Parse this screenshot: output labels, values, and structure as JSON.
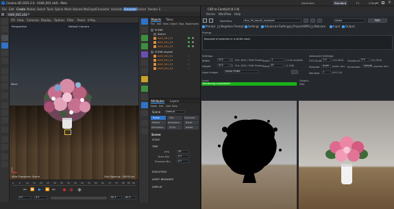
{
  "app": {
    "title": "Cinema 4D 2025.2.0 - [AI49_001.c4d] - Main"
  },
  "tabs": [
    "AI49_001.c4d"
  ],
  "menus": [
    "File",
    "Edit",
    "Create",
    "Modes",
    "Select",
    "Tools",
    "Spline",
    "Mesh",
    "Volume",
    "MoGraph",
    "Character",
    "Animate",
    "Simulate",
    "Tracker",
    "Render",
    "E"
  ],
  "viewport": {
    "menu": [
      "View",
      "Cameras",
      "Display",
      "Options",
      "Filter",
      "Panel",
      "V-Ray"
    ],
    "camera_label": "Perspective",
    "camera_name": "Default Camera",
    "transform_label": "View Transform: Scene",
    "grid_label": "Grid Spacing : 50000 cm",
    "move_label": "Move"
  },
  "timeline": {
    "frames": [
      "0",
      "5",
      "10",
      "15",
      "20",
      "25",
      "30",
      "35",
      "40",
      "45",
      "50",
      "55",
      "60",
      "65",
      "70",
      "75",
      "80",
      "85",
      "90"
    ],
    "start": "0 F",
    "current": "0 F",
    "end": "90 F",
    "end2": "90 F"
  },
  "layouts": {
    "active": "Standard",
    "items": [
      "Attributes",
      "Standard",
      "F1",
      "V-Ray"
    ]
  },
  "objects": {
    "tabs": [
      "Objects",
      "Takes"
    ],
    "menu": [
      "File",
      "Edit",
      "View",
      "Object",
      "Tags",
      "Bookmarks"
    ],
    "rows": [
      "SCENE",
      "Sketch",
      "AI49_001_01",
      "AI49_001_02",
      "AI49_001_03",
      "SCENE.original",
      "AI49_001_01",
      "AI49_001_02",
      "AI49_001_03",
      "AI49_001_04"
    ]
  },
  "attributes": {
    "tabs": [
      "Attributes",
      "Layers"
    ],
    "menu": [
      "Mode",
      "Edit",
      "User Data"
    ],
    "object": "Scene",
    "mode_value": "Default",
    "subtabs": [
      "Scene",
      "Info",
      "Channels",
      "Effects",
      "Animation",
      "Bullet",
      "Simulation",
      "To Do",
      "Nodes"
    ],
    "section": "Scene",
    "groups": [
      "SCALE",
      "TIME",
      "EXECUTION",
      "ASSET BROWSER",
      "DISPLAY"
    ],
    "fps_label": "FPS",
    "fps_value": "30",
    "min_label": "Time Min",
    "min_value": "0 F",
    "preview_label": "Preview Min",
    "preview_value": "0 F"
  },
  "comfy": {
    "title": "C4D to ComfyUI (0.1.6)",
    "menu": [
      "Server",
      "Workflow",
      "Help"
    ],
    "workflow_label": "Workflow",
    "workflow_value": "flux_50_Input1_example",
    "model_value": "Alpha",
    "run_label": "Run",
    "options": [
      "Prompt",
      "Negative Prompt",
      "Settings",
      "Advanced Settings",
      "Project/WPG",
      "Webcam",
      "Input",
      "Output"
    ],
    "prompt_label": "Prompt",
    "prompt_text": "Bouquet of peonies in a white vase",
    "settings_label": "Settings",
    "width_label": "Width",
    "width_value": "512",
    "width_hint": "Ctrl: 1024 / Shift: Preset",
    "height_label": "Height",
    "height_value": "512",
    "height_hint": "Ctrl: 1024 / Shift: Preset",
    "seed_label": "Seed",
    "seed_value": "-1",
    "seed_hint": "(-1 for random)",
    "steps_label": "Steps",
    "steps_value": "20",
    "steps_hint": "(1-100)",
    "input_image_label": "Input Image",
    "input_image_value": "Alpha RGBA",
    "adv_label": "Advanced Settings",
    "cfg_label": "CFG Scale",
    "cfg_value": "1.0",
    "cfg_range": "(1.0-20.0)",
    "guidance_label": "Guidance",
    "guidance_value": "3.5",
    "guidance_range": "(1.0-20.0)",
    "sampler_label": "Sampler",
    "sampler_value": "euler",
    "sampler_hint": "(euler, etc.)",
    "scheduler_label": "Scheduler",
    "scheduler_value": "simple",
    "scheduler_hint": "(normal, etc.)",
    "denoise_label": "Denoise",
    "denoise_value": "1",
    "denoise_range": "(0.0-1.0)",
    "input_label": "Input",
    "status_text": "Rendering completed!",
    "output_label": "Output",
    "output_sub": "title"
  },
  "colors": {
    "accent": "#3aa0ff",
    "success": "#19b319",
    "object_orange": "#e08a3a"
  }
}
